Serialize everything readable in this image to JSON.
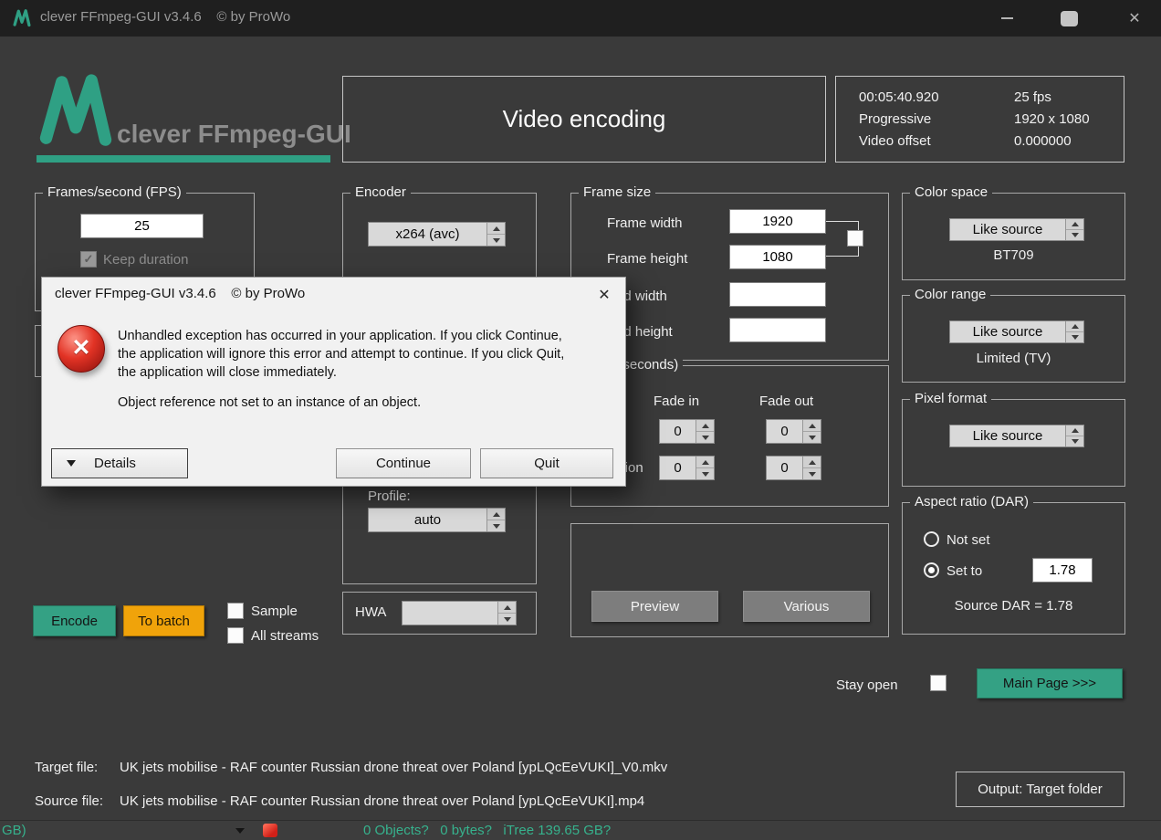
{
  "titlebar": {
    "title": "clever FFmpeg-GUI v3.4.6    © by ProWo"
  },
  "icons": {
    "close": "✕",
    "minimize": "–",
    "error_x": "✕"
  },
  "logo": {
    "text": "clever FFmpeg-GUI"
  },
  "header": {
    "page_title": "Video encoding"
  },
  "media_info": {
    "time": "00:05:40.920",
    "fps": "25 fps",
    "scan": "Progressive",
    "resolution": "1920 x 1080",
    "offset_label": "Video offset",
    "offset": "0.000000"
  },
  "fps": {
    "group_title": "Frames/second (FPS)",
    "value": "25",
    "keep_duration_label": "Keep duration"
  },
  "encoder": {
    "group_title": "Encoder",
    "value": "x264 (avc)",
    "profile_label": "Profile:",
    "profile_value": "auto"
  },
  "hwa": {
    "label": "HWA",
    "value": ""
  },
  "frame_size": {
    "group_title": "Frame size",
    "width_label": "Frame width",
    "width": "1920",
    "height_label": "Frame height",
    "height": "1080",
    "pad_width_label": "Pad width",
    "pad_width": "",
    "pad_height_label": "Pad height",
    "pad_height": ""
  },
  "fade": {
    "group_title": "Fade (seconds)",
    "in_label": "Fade in",
    "out_label": "Fade out",
    "in_value": "0",
    "out_value": "0",
    "duration_label": "Duration",
    "duration_in": "0",
    "duration_out": "0"
  },
  "color_space": {
    "group_title": "Color space",
    "value": "Like source",
    "detail": "BT709"
  },
  "color_range": {
    "group_title": "Color range",
    "value": "Like source",
    "detail": "Limited (TV)"
  },
  "pixel_format": {
    "group_title": "Pixel format",
    "value": "Like source"
  },
  "aspect_ratio": {
    "group_title": "Aspect ratio (DAR)",
    "not_set_label": "Not set",
    "set_to_label": "Set to",
    "value": "1.78",
    "source_label": "Source DAR = 1.78"
  },
  "dialog": {
    "title": "clever FFmpeg-GUI v3.4.6    © by ProWo",
    "message": "Unhandled exception has occurred in your application. If you click Continue, the application will ignore this error and attempt to continue. If you click Quit, the application will close immediately.",
    "message2": "Object reference not set to an instance of an object.",
    "details_label": "Details",
    "continue_label": "Continue",
    "quit_label": "Quit"
  },
  "actions": {
    "encode": "Encode",
    "to_batch": "To batch",
    "sample": "Sample",
    "all_streams": "All streams",
    "preview": "Preview",
    "various": "Various",
    "stay_open": "Stay open",
    "main_page": "Main Page >>>",
    "output": "Output: Target folder"
  },
  "files": {
    "target_label": "Target file:",
    "target_value": "UK jets mobilise - RAF counter Russian drone threat over Poland [ypLQcEeVUKI]_V0.mkv",
    "source_label": "Source file:",
    "source_value": "UK jets mobilise - RAF counter Russian drone threat over Poland [ypLQcEeVUKI].mp4"
  },
  "background_window": {
    "left_fragment": "GB)",
    "status_fragment": "0 Objects?   0 bytes?   iTree 139.65 GB?"
  },
  "colors": {
    "accent_teal": "#2FA084",
    "batch_orange": "#F0A30A",
    "error_red": "#D02B20"
  }
}
